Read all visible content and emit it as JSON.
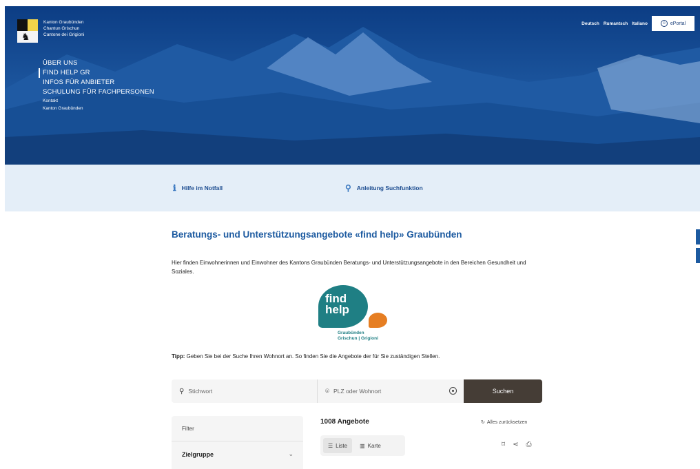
{
  "header": {
    "canton_names": [
      "Kanton Graubünden",
      "Chantun Grischun",
      "Cantone dei Grigioni"
    ],
    "languages": [
      "Deutsch",
      "Rumantsch",
      "Italiano"
    ],
    "eportal_label": "ePortal",
    "nav": [
      {
        "label": "ÜBER UNS"
      },
      {
        "label": "FIND HELP GR"
      },
      {
        "label": "INFOS FÜR ANBIETER"
      },
      {
        "label": "SCHULUNG FÜR FACHPERSONEN"
      },
      {
        "label": "Kontakt"
      },
      {
        "label": "Kanton Graubünden"
      }
    ]
  },
  "help_band": {
    "emergency_label": "Hilfe im Notfall",
    "guide_label": "Anleitung Suchfunktion"
  },
  "main": {
    "title": "Beratungs- und Unterstützungsangebote «find help» Graubünden",
    "intro": "Hier finden Einwohnerinnen und Einwohner des Kantons Graubünden Beratungs- und Unterstützungsangebote in den Bereichen Gesundheit und Soziales.",
    "logo": {
      "line1": "find",
      "line2": "help",
      "caption1": "Graubünden",
      "caption2": "Grischun | Grigioni"
    },
    "tip_label": "Tipp:",
    "tip_text": " Geben Sie bei der Suche Ihren Wohnort an. So finden Sie die Angebote der für Sie zuständigen Stellen."
  },
  "search": {
    "keyword_placeholder": "Stichwort",
    "location_placeholder": "PLZ oder Wohnort",
    "submit_label": "Suchen"
  },
  "filter": {
    "label": "Filter",
    "group_label": "Zielgruppe"
  },
  "results": {
    "count_label": "1008 Angebote",
    "reset_label": "Alles zurücksetzen",
    "view_list": "Liste",
    "view_map": "Karte"
  },
  "colors": {
    "brand_blue": "#1c5aa0",
    "search_button": "#453d36",
    "band_bg": "#e4eef8"
  }
}
